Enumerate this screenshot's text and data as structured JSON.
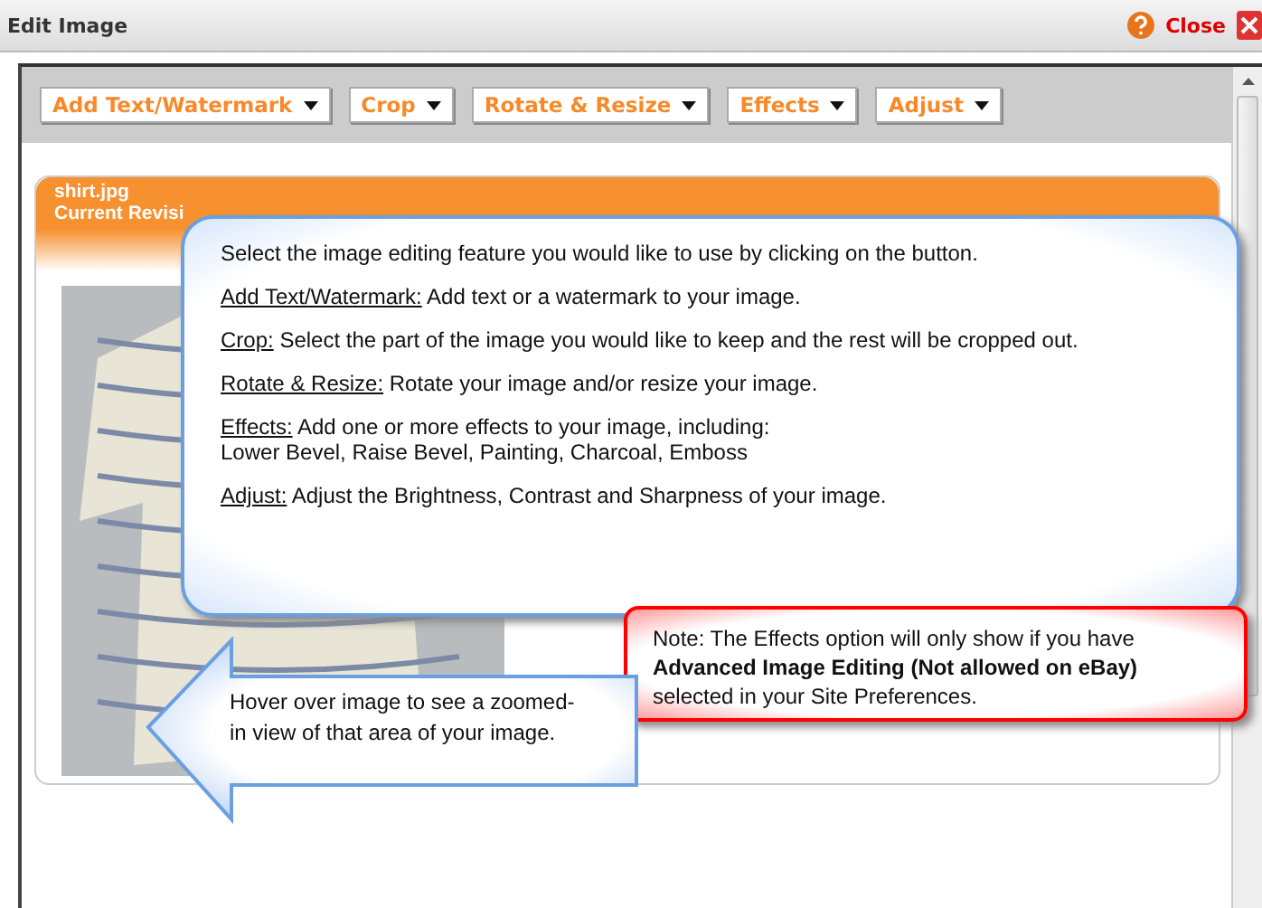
{
  "window": {
    "title": "Edit Image",
    "close_label": "Close"
  },
  "toolbar": [
    {
      "label": "Add Text/Watermark"
    },
    {
      "label": "Crop"
    },
    {
      "label": "Rotate & Resize"
    },
    {
      "label": "Effects"
    },
    {
      "label": "Adjust"
    }
  ],
  "image_card": {
    "filename": "shirt.jpg",
    "revision": "Current Revisi"
  },
  "help_callout": {
    "intro": "Select the image editing feature you would like to use by clicking on the button.",
    "items": [
      {
        "term": "Add Text/Watermark:",
        "text": "Add text or a watermark to your image."
      },
      {
        "term": "Crop:",
        "text": "Select the part of the image you would like to keep and the rest will be cropped out."
      },
      {
        "term": "Rotate & Resize:",
        "text": "Rotate your image and/or resize your image."
      },
      {
        "term": "Effects:",
        "text": " Add one or more effects to your image, including:",
        "extra": "Lower Bevel, Raise Bevel, Painting, Charcoal, Emboss"
      },
      {
        "term": "Adjust:",
        "text": "Adjust the Brightness, Contrast and Sharpness of your image."
      }
    ]
  },
  "note_callout": {
    "text": "Note: The Effects option will only show if you have **Advanced Image Editing (Not allowed on eBay)** selected in your Site Preferences."
  },
  "arrow_callout": {
    "text": "Hover over image to see a zoomed-in view of that area of your image."
  }
}
